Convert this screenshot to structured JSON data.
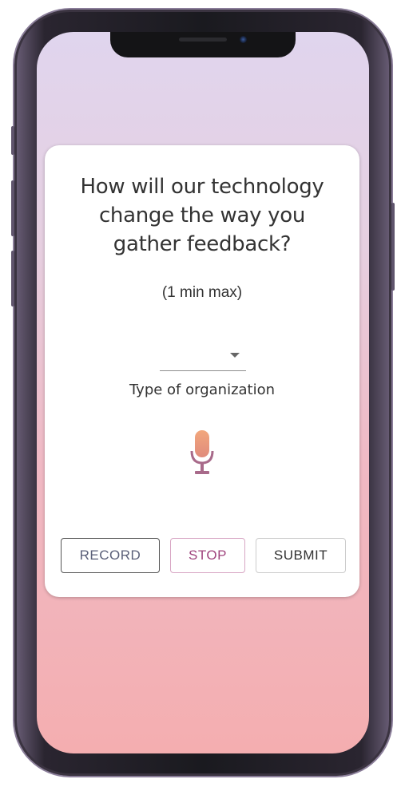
{
  "question": {
    "line1": "How will our technology",
    "line2": "change the way you",
    "line3": "gather feedback?"
  },
  "subtitle": "(1 min max)",
  "organization_select": {
    "value": "",
    "label": "Type of organization"
  },
  "buttons": {
    "record": "RECORD",
    "stop": "STOP",
    "submit": "SUBMIT"
  },
  "colors": {
    "gradient_top": "#e0d5ee",
    "gradient_bottom": "#f4aeb0",
    "stop_accent": "#a0457e",
    "record_text": "#5a5f78"
  },
  "icons": {
    "microphone": "microphone-icon",
    "dropdown": "chevron-down-icon"
  }
}
